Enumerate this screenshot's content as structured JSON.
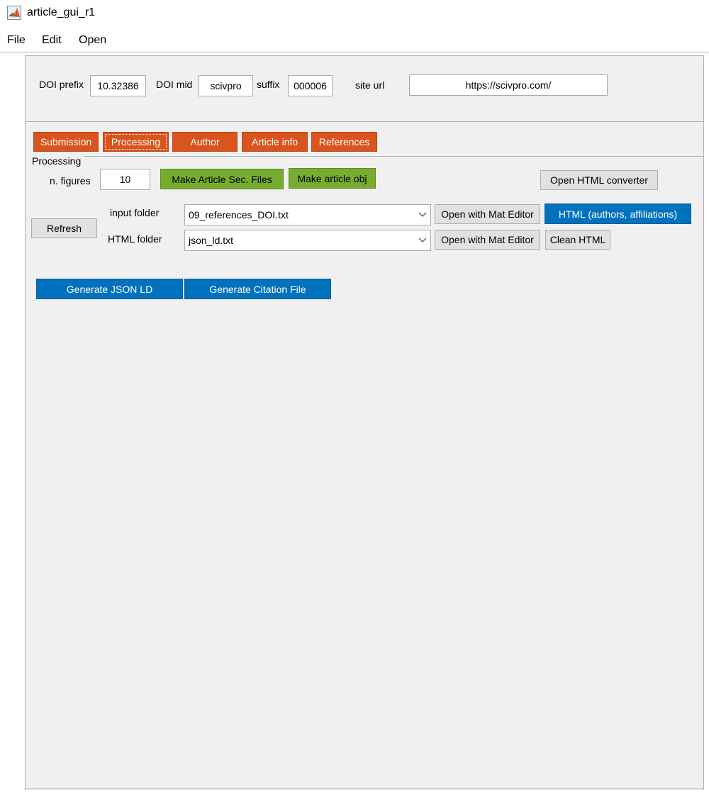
{
  "window": {
    "title": "article_gui_r1"
  },
  "menu": {
    "items": [
      "File",
      "Edit",
      "Open"
    ]
  },
  "doi": {
    "prefix_label": "DOI prefix",
    "prefix_value": "10.32386",
    "mid_label": "DOI mid",
    "mid_value": "scivpro",
    "suffix_label": "suffix",
    "suffix_value": "000006",
    "site_label": "site url",
    "site_value": "https://scivpro.com/"
  },
  "tabs": [
    "Submission",
    "Processing",
    "Author",
    "Article info",
    "References"
  ],
  "active_tab": "Processing",
  "processing": {
    "title": "Processing",
    "n_figures_label": "n. figures",
    "n_figures_value": "10",
    "make_sec_files": "Make Article Sec. Files",
    "make_article_obj": "Make article obj",
    "open_html_converter": "Open HTML converter",
    "refresh": "Refresh",
    "input_folder_label": "input folder",
    "input_folder_value": "09_references_DOI.txt",
    "html_folder_label": "HTML folder",
    "html_folder_value": "json_ld.txt",
    "open_mat_editor_1": "Open with Mat Editor",
    "open_mat_editor_2": "Open with Mat Editor",
    "html_authors": "HTML (authors, affiliations)",
    "clean_html": "Clean HTML",
    "generate_json_ld": "Generate JSON LD",
    "generate_citation": "Generate Citation File"
  },
  "colors": {
    "tab_orange": "#d9541e",
    "button_green": "#77ac30",
    "button_blue": "#0072bd",
    "panel_bg": "#f0f0f0"
  }
}
